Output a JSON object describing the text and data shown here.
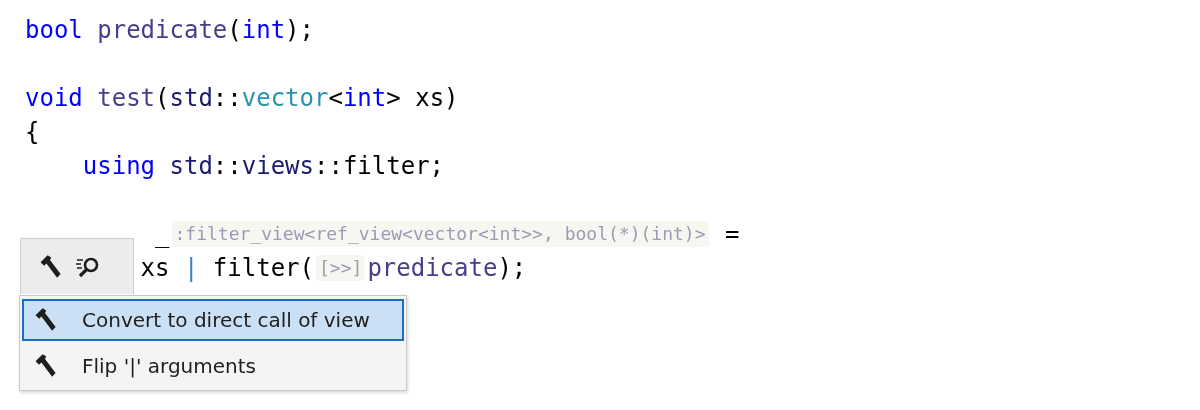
{
  "code": {
    "lines": [
      {
        "kind": "code",
        "tokens": [
          {
            "text": "bool",
            "kind": "keyword"
          },
          {
            "text": " predicate",
            "kind": "function"
          },
          {
            "text": "(",
            "kind": "plain"
          },
          {
            "text": "int",
            "kind": "keyword"
          },
          {
            "text": ");",
            "kind": "plain"
          }
        ]
      },
      {
        "kind": "blank"
      },
      {
        "kind": "code",
        "tokens": [
          {
            "text": "void",
            "kind": "keyword"
          },
          {
            "text": " test",
            "kind": "function"
          },
          {
            "text": "(",
            "kind": "plain"
          },
          {
            "text": "std",
            "kind": "namespace"
          },
          {
            "text": "::",
            "kind": "plain"
          },
          {
            "text": "vector",
            "kind": "type"
          },
          {
            "text": "<",
            "kind": "plain"
          },
          {
            "text": "int",
            "kind": "keyword"
          },
          {
            "text": "> xs)",
            "kind": "plain"
          }
        ]
      },
      {
        "kind": "code",
        "tokens": [
          {
            "text": "{",
            "kind": "plain"
          }
        ]
      },
      {
        "kind": "code",
        "tokens": [
          {
            "text": "    using",
            "kind": "keyword"
          },
          {
            "text": " std",
            "kind": "namespace"
          },
          {
            "text": "::",
            "kind": "plain"
          },
          {
            "text": "views",
            "kind": "namespace"
          },
          {
            "text": "::filter;",
            "kind": "plain"
          }
        ]
      },
      {
        "kind": "blank"
      },
      {
        "kind": "code",
        "tokens": [
          {
            "text": "         _",
            "kind": "plain"
          },
          {
            "text": ":filter_view<ref_view<vector<int>>, bool(*)(int)>",
            "kind": "hint"
          },
          {
            "text": " =",
            "kind": "plain"
          }
        ]
      },
      {
        "kind": "code",
        "tokens": [
          {
            "text": "        xs ",
            "kind": "plain"
          },
          {
            "text": "|",
            "kind": "operator"
          },
          {
            "text": " filter(",
            "kind": "plain"
          },
          {
            "text": "[>>]",
            "kind": "hint"
          },
          {
            "text": "predicate",
            "kind": "function"
          },
          {
            "text": ");",
            "kind": "plain"
          }
        ]
      }
    ]
  },
  "popup": {
    "toolbar": [
      {
        "kind": "hammer"
      },
      {
        "kind": "search"
      }
    ],
    "items": [
      {
        "label": "Convert to direct call of view",
        "selected": true
      },
      {
        "label": "Flip '|' arguments",
        "selected": false
      }
    ]
  }
}
